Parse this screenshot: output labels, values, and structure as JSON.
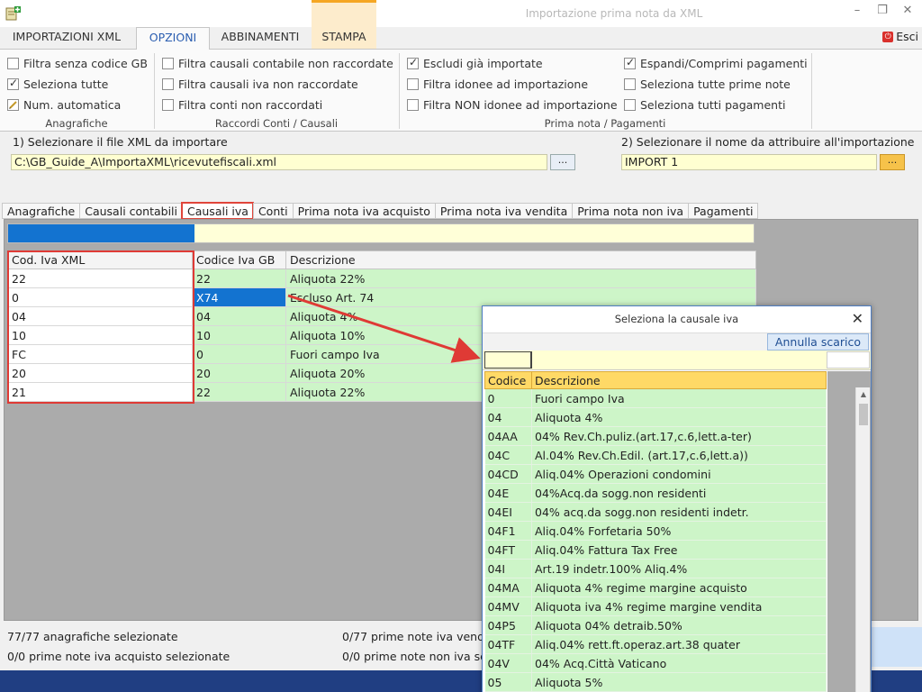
{
  "window": {
    "title": "Importazione prima nota da XML",
    "minimize": "–",
    "restore": "❐",
    "close": "✕"
  },
  "ribbon_tabs": [
    "IMPORTAZIONI XML",
    "OPZIONI",
    "ABBINAMENTI",
    "STAMPA"
  ],
  "esci_label": "Esci",
  "groups": {
    "anagrafiche": {
      "label": "Anagrafiche",
      "items": [
        {
          "label": "Filtra senza codice GB",
          "checked": false
        },
        {
          "label": "Seleziona tutte",
          "checked": true
        },
        {
          "label": "Num. automatica",
          "checked": false
        }
      ]
    },
    "raccordi": {
      "label": "Raccordi Conti / Causali",
      "items": [
        {
          "label": "Filtra causali contabile non raccordate",
          "checked": false
        },
        {
          "label": "Filtra causali iva non raccordate",
          "checked": false
        },
        {
          "label": "Filtra conti non raccordati",
          "checked": false
        }
      ]
    },
    "primanota_a": {
      "items": [
        {
          "label": "Escludi già importate",
          "checked": true
        },
        {
          "label": "Filtra idonee ad importazione",
          "checked": false
        },
        {
          "label": "Filtra NON idonee ad importazione",
          "checked": false
        }
      ]
    },
    "primanota_b": {
      "items": [
        {
          "label": "Espandi/Comprimi pagamenti",
          "checked": true
        },
        {
          "label": "Seleziona tutte prime note",
          "checked": false
        },
        {
          "label": "Seleziona tutti pagamenti",
          "checked": false
        }
      ]
    },
    "primanota_label": "Prima nota / Pagamenti"
  },
  "file": {
    "label": "1) Selezionare il file XML da importare",
    "value": "C:\\GB_Guide_A\\ImportaXML\\ricevutefiscali.xml",
    "browse": "..."
  },
  "import_name": {
    "label": "2) Selezionare il nome da attribuire all'importazione",
    "value": "IMPORT 1",
    "browse": "..."
  },
  "data_tabs": [
    "Anagrafiche",
    "Causali contabili",
    "Causali iva",
    "Conti",
    "Prima nota iva acquisto",
    "Prima nota iva vendita",
    "Prima nota non iva",
    "Pagamenti"
  ],
  "progress": {
    "fraction": 0.25
  },
  "grid": {
    "headers": [
      "Cod. Iva XML",
      "Codice Iva GB",
      "Descrizione"
    ],
    "rows": [
      [
        "22",
        "22",
        "Aliquota 22%"
      ],
      [
        "0",
        "X74",
        "Escluso Art. 74"
      ],
      [
        "04",
        "04",
        "Aliquota 4%"
      ],
      [
        "10",
        "10",
        "Aliquota 10%"
      ],
      [
        "FC",
        "0",
        "Fuori campo Iva"
      ],
      [
        "20",
        "20",
        "Aliquota 20%"
      ],
      [
        "21",
        "22",
        "Aliquota 22%"
      ]
    ]
  },
  "status": {
    "anagrafiche": "77/77 anagrafiche selezionate",
    "acquisto": "0/0 prime note iva acquisto selezionate",
    "vendita": "0/77 prime note iva vendita selezionate",
    "nonivа": "0/0 prime note non iva selezionate"
  },
  "popup": {
    "title": "Seleziona la causale iva",
    "close": "✕",
    "annulla": "Annulla scarico",
    "headers": [
      "Codice",
      "Descrizione"
    ],
    "rows": [
      [
        "0",
        "Fuori campo Iva"
      ],
      [
        "04",
        "Aliquota 4%"
      ],
      [
        "04AA",
        "04% Rev.Ch.puliz.(art.17,c.6,lett.a-ter)"
      ],
      [
        "04C",
        "Al.04% Rev.Ch.Edil. (art.17,c.6,lett.a))"
      ],
      [
        "04CD",
        "Aliq.04% Operazioni condomini"
      ],
      [
        "04E",
        "04%Acq.da sogg.non residenti"
      ],
      [
        "04EI",
        "04% acq.da sogg.non residenti indetr."
      ],
      [
        "04F1",
        "Aliq.04% Forfetaria 50%"
      ],
      [
        "04FT",
        "Aliq.04% Fattura Tax Free"
      ],
      [
        "04I",
        "Art.19 indetr.100% Aliq.4%"
      ],
      [
        "04MA",
        "Aliquota 4% regime margine acquisto"
      ],
      [
        "04MV",
        "Aliquota iva 4% regime margine vendita"
      ],
      [
        "04P5",
        "Aliquota 04% detraib.50%"
      ],
      [
        "04TF",
        "Aliq.04% rett.ft.operaz.art.38 quater"
      ],
      [
        "04V",
        "04% Acq.Città Vaticano"
      ],
      [
        "05",
        "Aliquota 5%"
      ]
    ]
  },
  "colors": {
    "accent": "#1373d0",
    "highlight_red": "#df3a35",
    "row_green": "#cdf5c8",
    "field_yellow": "#ffffd1",
    "bottom_bar": "#203e82"
  }
}
